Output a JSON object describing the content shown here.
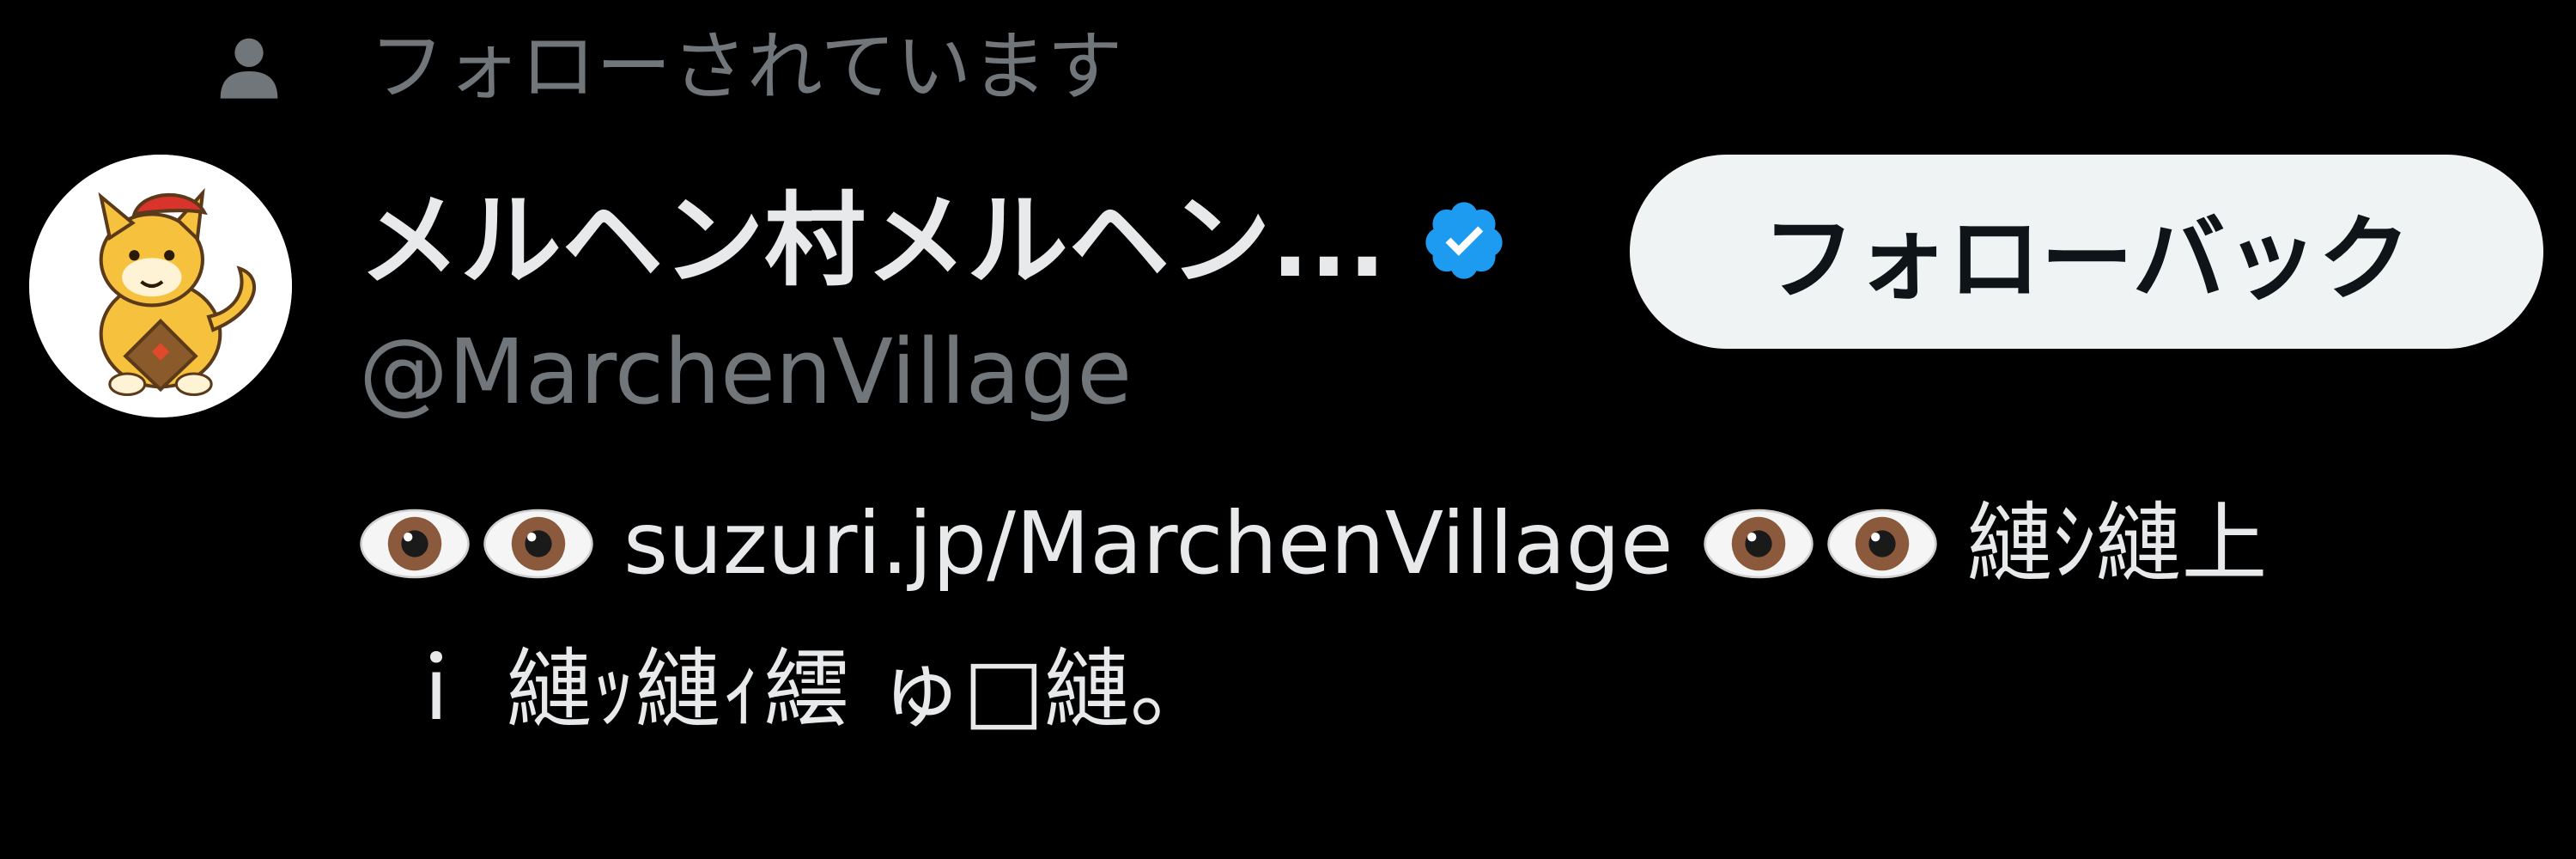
{
  "social_context": {
    "icon": "person-icon",
    "text": "フォローされています"
  },
  "user": {
    "avatar_icon": "mascot-avatar",
    "display_name": "メルヘン村メルヘン...",
    "verified_icon": "verified-badge-icon",
    "handle": "@MarchenVillage"
  },
  "follow_back_button": {
    "label": "フォローバック"
  },
  "bio": {
    "eyes_icon": "eyes-emoji",
    "link_text": "suzuri.jp/MarchenVillage",
    "line1_tail": "縺ｼ縺上",
    "line2": "ｉ 縺ｯ縺ｨ繧 ゅ□縺。"
  },
  "colors": {
    "background": "#000000",
    "primary_text": "#e7e9ea",
    "secondary_text": "#71767b",
    "verified": "#1d9bf0",
    "button_bg": "#eff3f4",
    "button_text": "#0f1419"
  }
}
